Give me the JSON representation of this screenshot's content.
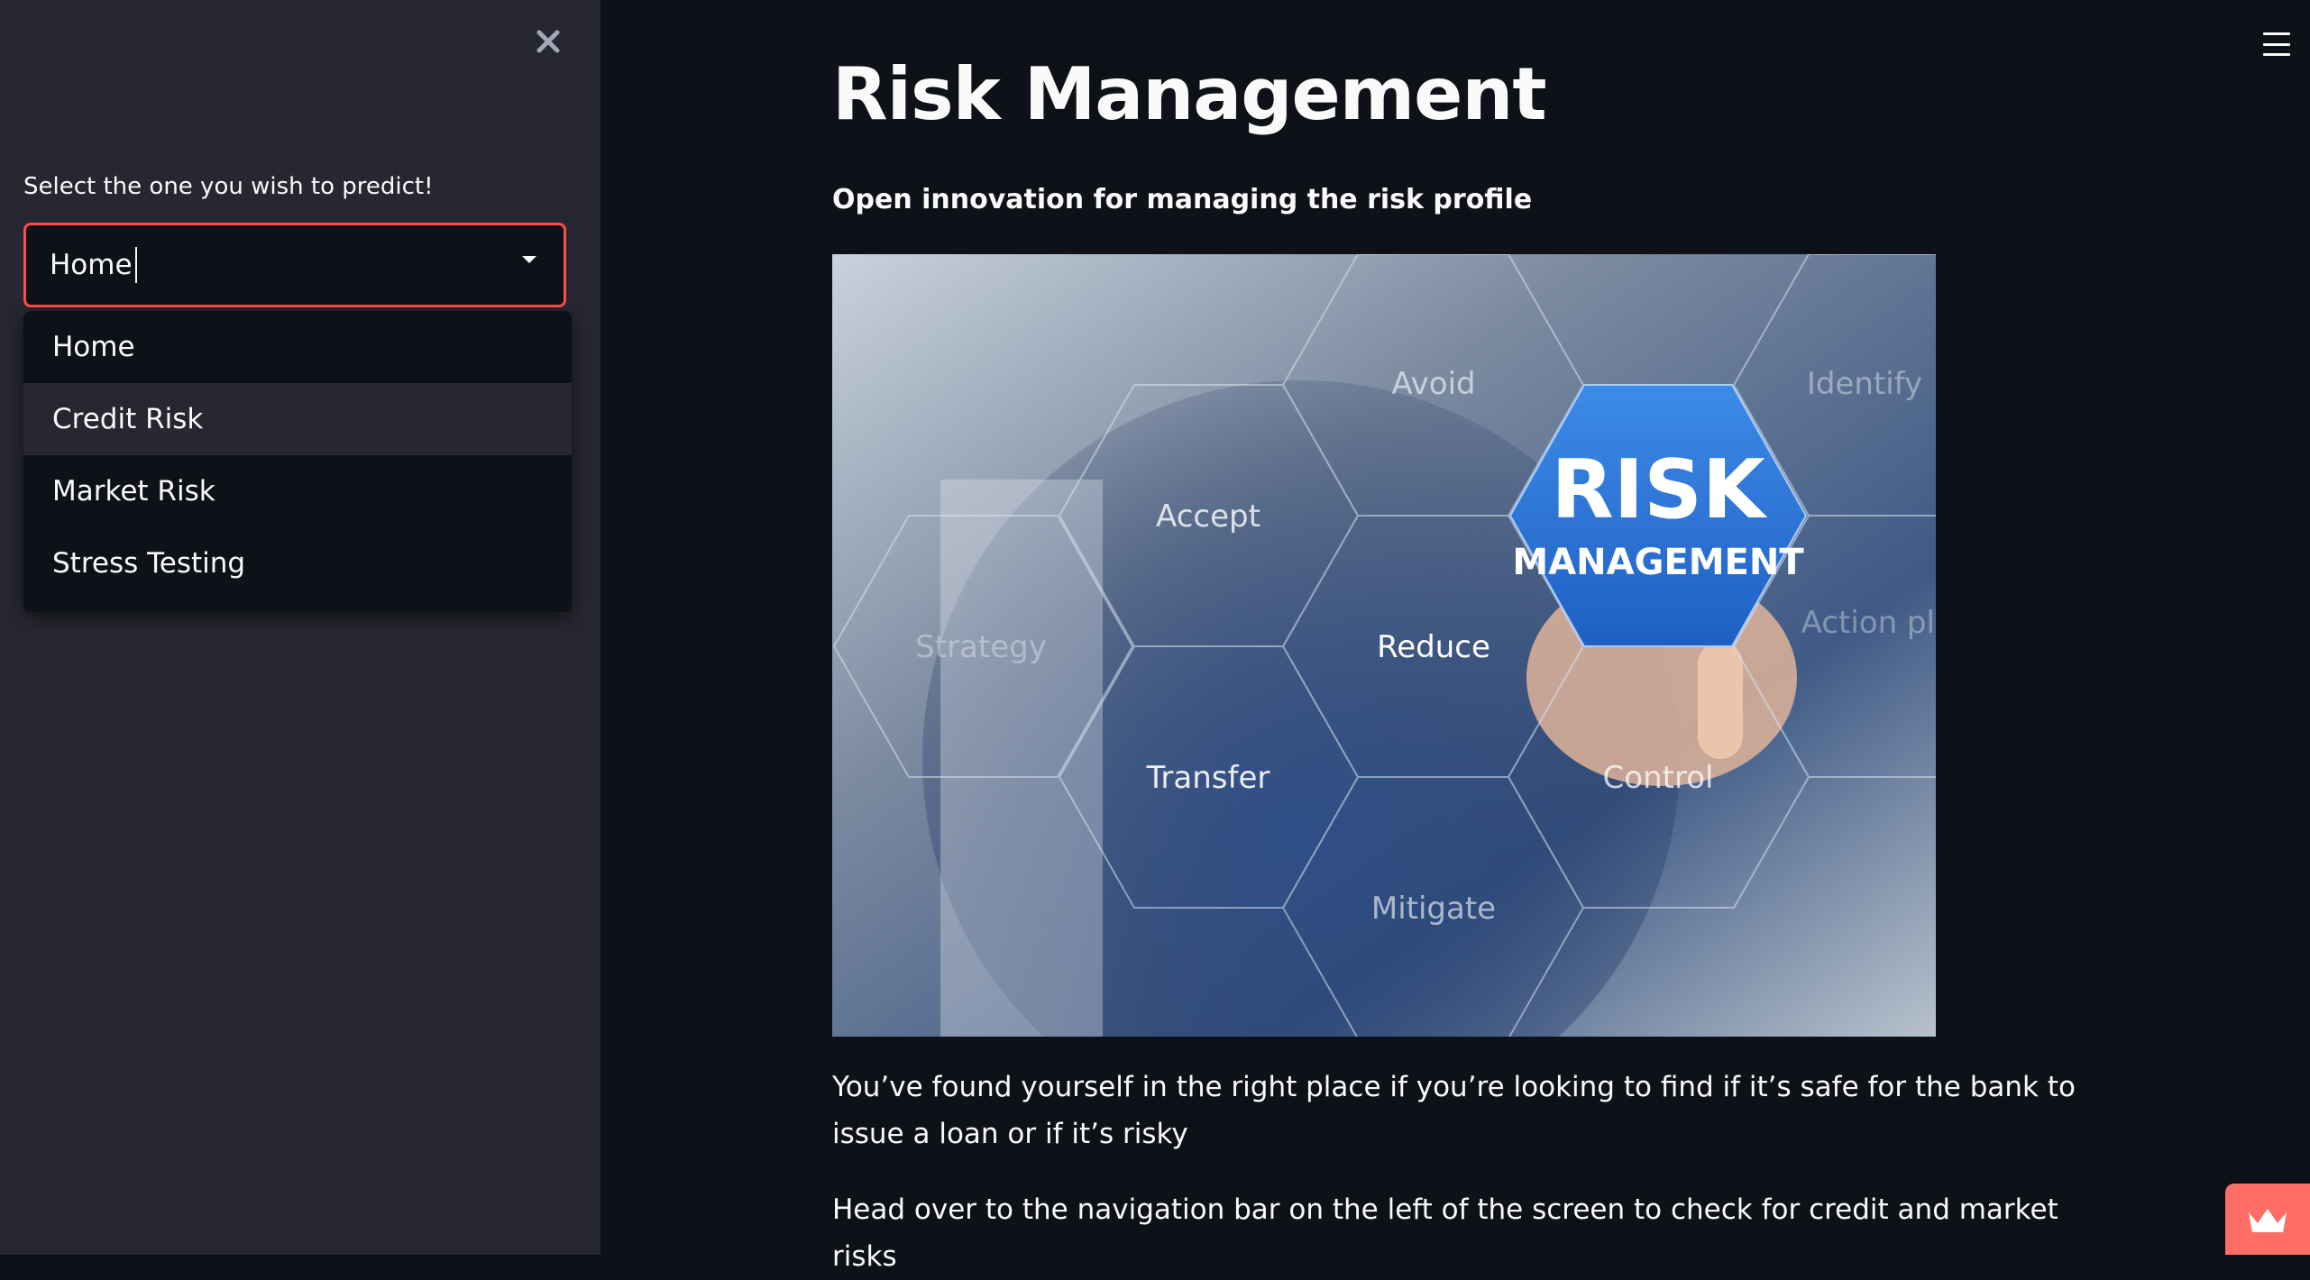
{
  "sidebar": {
    "close_icon": "close-icon",
    "select_label": "Select the one you wish to predict!",
    "select_value": "Home",
    "options": [
      "Home",
      "Credit Risk",
      "Market Risk",
      "Stress Testing"
    ],
    "highlighted_option": "Credit Risk"
  },
  "header": {
    "menu_icon": "hamburger-menu-icon"
  },
  "main": {
    "title": "Risk Management",
    "subtitle": "Open innovation for managing the risk profile",
    "image": {
      "center_line1": "RISK",
      "center_line2": "MANAGEMENT",
      "hex_labels": [
        "Avoid",
        "Identify",
        "Accept",
        "Strategy",
        "Reduce",
        "Action plan",
        "Transfer",
        "Control",
        "Mitigate"
      ]
    },
    "paragraph1": "You’ve found yourself in the right place if you’re looking to find if it’s safe for the bank to issue a loan or if it’s risky",
    "paragraph2": "Head over to the navigation bar on the left of the screen to check for credit and market risks"
  },
  "colors": {
    "background": "#0e1117",
    "sidebar": "#262730",
    "accent": "#ff4b4b",
    "badge": "#ff6e66"
  }
}
